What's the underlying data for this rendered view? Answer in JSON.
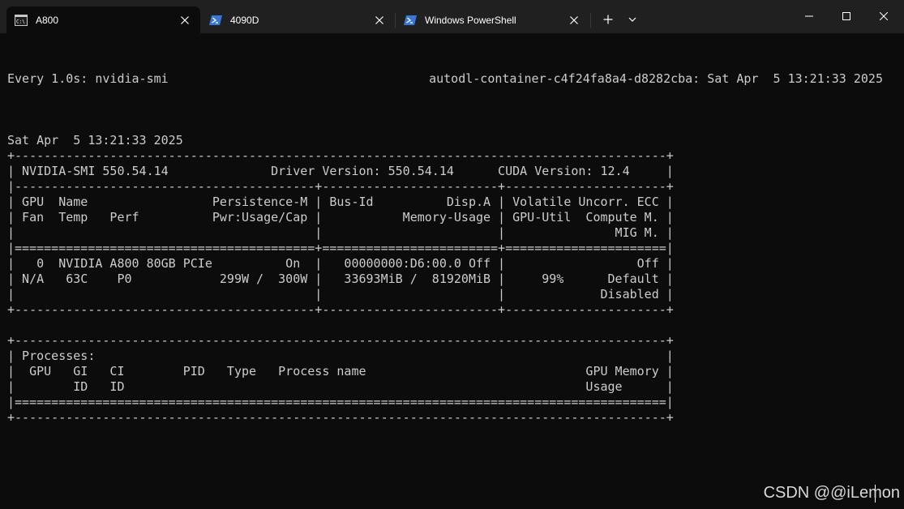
{
  "tabs": [
    {
      "label": "A800",
      "icon": "cmd-icon",
      "active": true
    },
    {
      "label": "4090D",
      "icon": "powershell-icon",
      "active": false
    },
    {
      "label": "Windows PowerShell",
      "icon": "powershell-icon",
      "active": false
    }
  ],
  "tabbar": {
    "new_tab_glyph": "+",
    "dropdown_icon": "chevron-down-icon"
  },
  "window_controls": [
    "minimize-icon",
    "maximize-icon",
    "close-icon"
  ],
  "colors": {
    "background": "#0c0c0c",
    "tabbar": "#202020",
    "text": "#cccccc",
    "powershell_icon": "#3a78d8"
  },
  "terminal": {
    "header_left": "Every 1.0s: nvidia-smi",
    "header_right": "autodl-container-c4f24fa8a4-d8282cba: Sat Apr  5 13:21:33 2025",
    "lines": [
      "",
      "Sat Apr  5 13:21:33 2025",
      "+-----------------------------------------------------------------------------------------+",
      "| NVIDIA-SMI 550.54.14              Driver Version: 550.54.14      CUDA Version: 12.4     |",
      "|-----------------------------------------+------------------------+----------------------+",
      "| GPU  Name                 Persistence-M | Bus-Id          Disp.A | Volatile Uncorr. ECC |",
      "| Fan  Temp   Perf          Pwr:Usage/Cap |           Memory-Usage | GPU-Util  Compute M. |",
      "|                                         |                        |               MIG M. |",
      "|=========================================+========================+======================|",
      "|   0  NVIDIA A800 80GB PCIe          On  |   00000000:D6:00.0 Off |                  Off |",
      "| N/A   63C    P0            299W /  300W |   33693MiB /  81920MiB |     99%      Default |",
      "|                                         |                        |             Disabled |",
      "+-----------------------------------------+------------------------+----------------------+",
      "",
      "+-----------------------------------------------------------------------------------------+",
      "| Processes:                                                                              |",
      "|  GPU   GI   CI        PID   Type   Process name                              GPU Memory |",
      "|        ID   ID                                                               Usage      |",
      "|=========================================================================================|",
      "+-----------------------------------------------------------------------------------------+"
    ]
  },
  "watermark": "CSDN @@iLemon"
}
